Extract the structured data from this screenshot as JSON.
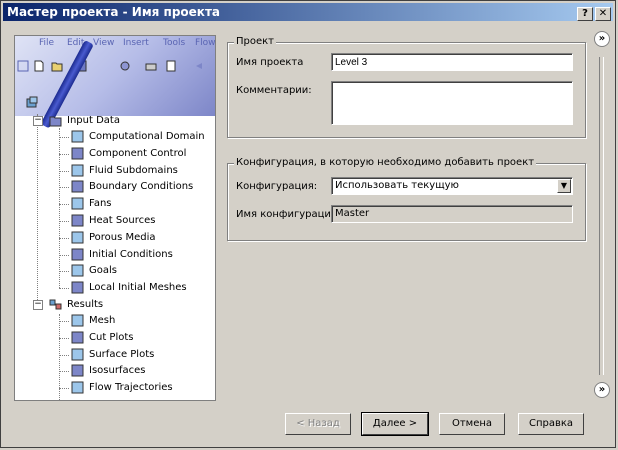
{
  "window": {
    "title": "Мастер проекта - Имя проекта",
    "help_button": "?",
    "close_button": "✕"
  },
  "banner": {
    "menu": [
      "File",
      "Edit",
      "View",
      "Insert",
      "Tools",
      "Flow"
    ]
  },
  "tree": {
    "input_data": {
      "label": "Input Data",
      "children": [
        {
          "label": "Computational Domain",
          "icon": "domain-icon"
        },
        {
          "label": "Component Control",
          "icon": "component-icon"
        },
        {
          "label": "Fluid Subdomains",
          "icon": "fluid-subdomain-icon"
        },
        {
          "label": "Boundary Conditions",
          "icon": "boundary-icon"
        },
        {
          "label": "Fans",
          "icon": "fan-icon"
        },
        {
          "label": "Heat Sources",
          "icon": "heat-source-icon"
        },
        {
          "label": "Porous Media",
          "icon": "porous-media-icon"
        },
        {
          "label": "Initial Conditions",
          "icon": "initial-conditions-icon"
        },
        {
          "label": "Goals",
          "icon": "goals-icon"
        },
        {
          "label": "Local Initial Meshes",
          "icon": "local-mesh-icon"
        }
      ]
    },
    "results": {
      "label": "Results",
      "children": [
        {
          "label": "Mesh",
          "icon": "mesh-icon"
        },
        {
          "label": "Cut Plots",
          "icon": "cut-plot-icon"
        },
        {
          "label": "Surface Plots",
          "icon": "surface-plot-icon"
        },
        {
          "label": "Isosurfaces",
          "icon": "isosurface-icon"
        },
        {
          "label": "Flow Trajectories",
          "icon": "flow-trajectory-icon"
        }
      ]
    }
  },
  "project_group": {
    "title": "Проект",
    "name_label": "Имя проекта",
    "name_value": "Level 3",
    "comment_label": "Комментарии:",
    "comment_value": ""
  },
  "config_group": {
    "title": "Конфигурация, в которую необходимо добавить проект",
    "config_label": "Конфигурация:",
    "config_value": "Использовать текущую",
    "config_name_label": "Имя конфигурации:",
    "config_name_value": "Master"
  },
  "buttons": {
    "back": "< Назад",
    "next": "Далее >",
    "cancel": "Отмена",
    "help": "Справка"
  },
  "colors": {
    "titlebar_start": "#0a246a",
    "titlebar_end": "#a6caf0",
    "dialog_bg": "#d4d0c8"
  }
}
